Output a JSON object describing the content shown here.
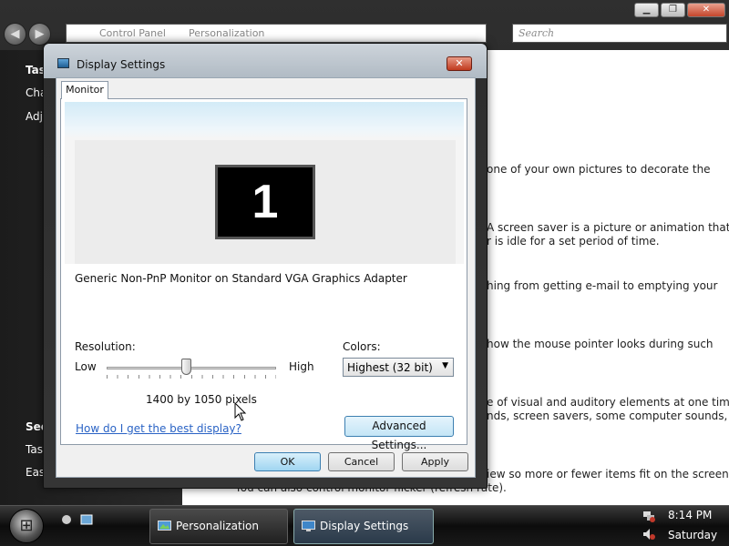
{
  "explorer": {
    "address_crumbs": [
      "Control Panel",
      "Personalization"
    ],
    "search_placeholder": "Search",
    "left_links": [
      {
        "label": "Tas",
        "bold": true
      },
      {
        "label": "Cha",
        "bold": false
      },
      {
        "label": "Adj",
        "bold": false
      },
      {
        "label": "See",
        "bold": true
      },
      {
        "label": "Tas",
        "bold": false
      },
      {
        "label": "Eas",
        "bold": false
      }
    ],
    "content_lines": [
      "one of your own pictures to decorate the",
      "A screen saver is a picture or animation that",
      "r is idle for a set period of time.",
      "hing from getting e-mail to emptying your",
      "how the mouse pointer looks during such",
      "e of visual and auditory elements at one time",
      "nds, screen savers, some computer sounds, and",
      "iew so more or fewer items fit on the screen.",
      "You can also control monitor flicker (refresh rate)."
    ]
  },
  "dialog": {
    "title": "Display Settings",
    "close_label": "✕",
    "tab_label": "Monitor",
    "monitor_number": "1",
    "monitor_description": "Generic Non-PnP Monitor on Standard VGA Graphics Adapter",
    "resolution_label": "Resolution:",
    "resolution_low": "Low",
    "resolution_high": "High",
    "resolution_value": "1400 by 1050 pixels",
    "resolution_slider_fraction": 0.47,
    "colors_label": "Colors:",
    "colors_value": "Highest (32 bit)",
    "help_link": "How do I get the best display?",
    "advanced_button": "Advanced Settings...",
    "ok_button": "OK",
    "cancel_button": "Cancel",
    "apply_button": "Apply"
  },
  "taskbar": {
    "tasks": [
      {
        "label": "Personalization",
        "icon": "personalization-icon",
        "active": false
      },
      {
        "label": "Display Settings",
        "icon": "display-settings-icon",
        "active": true
      }
    ],
    "time": "8:14 PM",
    "day": "Saturday"
  },
  "colors": {
    "link": "#2a63c5",
    "default_button": "#9fd5f1",
    "close_button": "#c0391d"
  }
}
